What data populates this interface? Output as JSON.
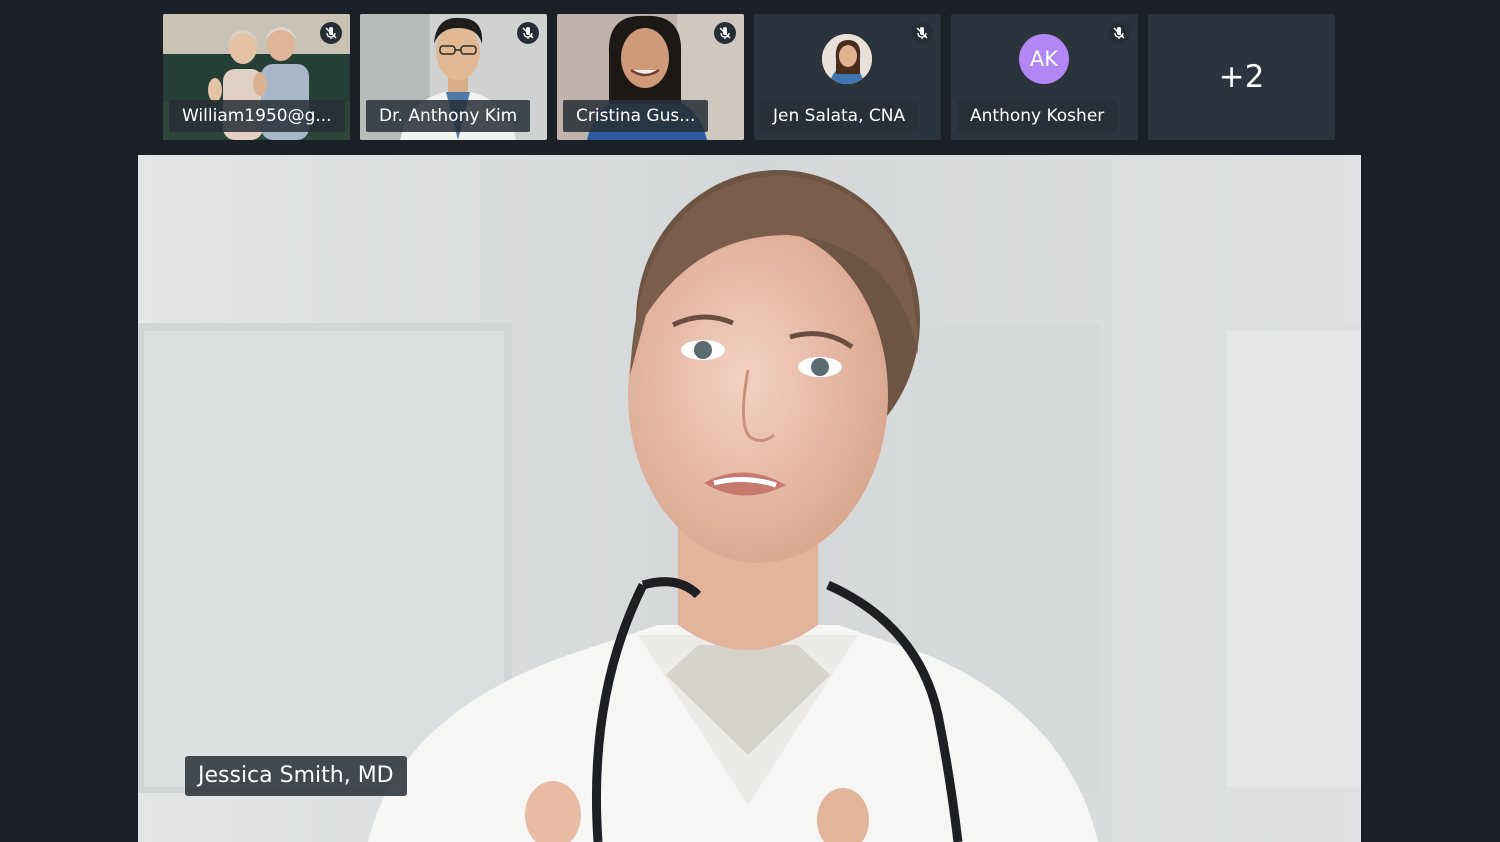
{
  "participants": [
    {
      "name": "William1950@g...",
      "muted": true,
      "video": "couple-waving"
    },
    {
      "name": "Dr. Anthony Kim",
      "muted": true,
      "video": "man-glasses"
    },
    {
      "name": "Cristina Gus...",
      "muted": true,
      "video": "woman-smiling"
    },
    {
      "name": "Jen Salata, CNA",
      "muted": true,
      "avatar": "photo"
    },
    {
      "name": "Anthony Kosher",
      "muted": true,
      "initials": "AK",
      "avatar_color": "#b287f4"
    }
  ],
  "overflow_count": "+2",
  "active_speaker": {
    "name": "Jessica Smith, MD"
  },
  "colors": {
    "background": "#1b2026",
    "tile": "#2b333d",
    "label_bg": "#282e36"
  },
  "icons": {
    "mute": "mic-off-icon"
  }
}
